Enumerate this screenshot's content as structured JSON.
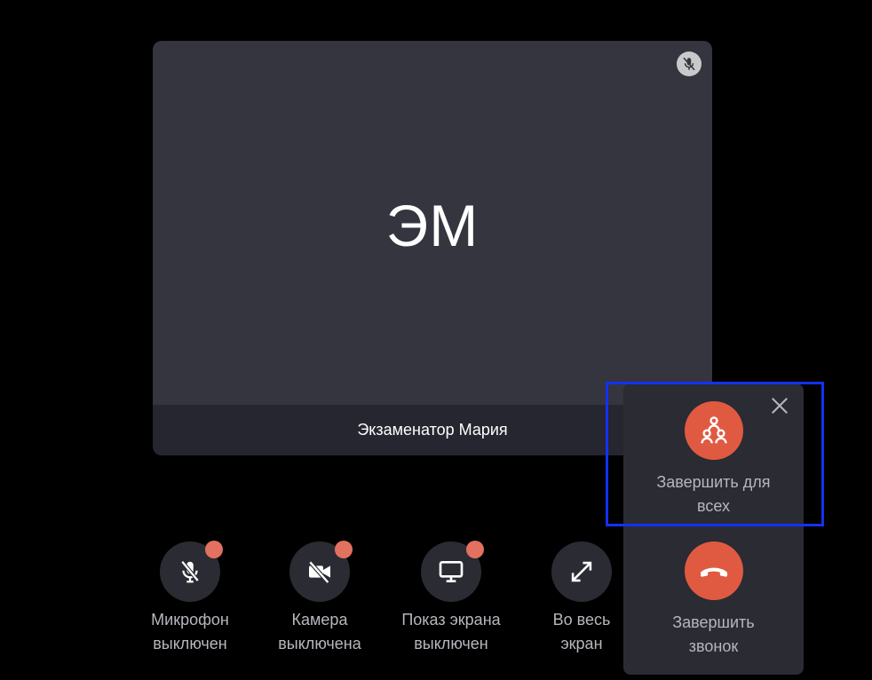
{
  "tile": {
    "initials": "ЭМ",
    "participant_name": "Экзаменатор Мария"
  },
  "controls": [
    {
      "name": "mic",
      "line1": "Микрофон",
      "line2": "выключен",
      "badge": true,
      "icon": "mic-off-icon"
    },
    {
      "name": "camera",
      "line1": "Камера",
      "line2": "выключена",
      "badge": true,
      "icon": "camera-off-icon"
    },
    {
      "name": "screenshare",
      "line1": "Показ экрана",
      "line2": "выключен",
      "badge": true,
      "icon": "monitor-icon"
    },
    {
      "name": "fullscreen",
      "line1": "Во весь",
      "line2": "экран",
      "badge": false,
      "icon": "expand-icon"
    }
  ],
  "popup": {
    "end_for_all_line1": "Завершить для",
    "end_for_all_line2": "всех",
    "end_call_line1": "Завершить",
    "end_call_line2": "звонок"
  },
  "colors": {
    "background": "#000000",
    "tile": "#34353f",
    "danger": "#e05a42",
    "badge": "#e2715f",
    "highlight": "#1431f2"
  }
}
